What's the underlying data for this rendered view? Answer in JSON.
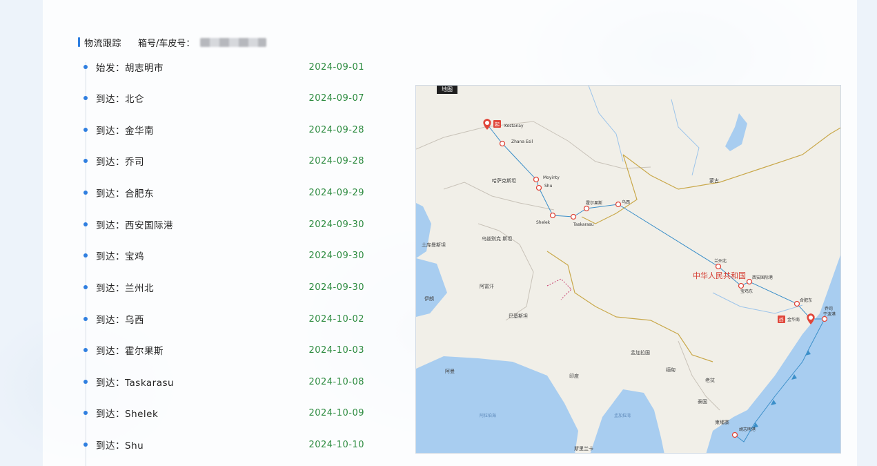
{
  "header": {
    "title": "物流跟踪",
    "box_label": "箱号/车皮号："
  },
  "timeline": [
    {
      "label": "始发：胡志明市",
      "date": "2024-09-01"
    },
    {
      "label": "到达：北仑",
      "date": "2024-09-07"
    },
    {
      "label": "到达：金华南",
      "date": "2024-09-28"
    },
    {
      "label": "到达：乔司",
      "date": "2024-09-28"
    },
    {
      "label": "到达：合肥东",
      "date": "2024-09-29"
    },
    {
      "label": "到达：西安国际港",
      "date": "2024-09-30"
    },
    {
      "label": "到达：宝鸡",
      "date": "2024-09-30"
    },
    {
      "label": "到达：兰州北",
      "date": "2024-09-30"
    },
    {
      "label": "到达：乌西",
      "date": "2024-10-02"
    },
    {
      "label": "到达：霍尔果斯",
      "date": "2024-10-03"
    },
    {
      "label": "到达：Taskarasu",
      "date": "2024-10-08"
    },
    {
      "label": "到达：Shelek",
      "date": "2024-10-09"
    },
    {
      "label": "到达：Shu",
      "date": "2024-10-10"
    }
  ],
  "map": {
    "badge": "地图",
    "country_labels": {
      "kazakhstan": "哈萨克斯坦",
      "mongolia": "蒙古",
      "uzbekistan": "乌兹别克\n斯坦",
      "turkmenistan": "土库曼斯坦",
      "afghanistan": "阿富汗",
      "iran": "伊朗",
      "pakistan": "巴基斯坦",
      "oman": "阿曼",
      "india": "印度",
      "bangladesh": "孟加拉国",
      "myanmar": "缅甸",
      "laos": "老挝",
      "thailand": "泰国",
      "cambodia": "柬埔寨",
      "srilanka": "斯里兰卡",
      "china": "中华人民共和国",
      "arabian_sea": "阿拉伯海",
      "bay_of_bengal": "孟加拉湾"
    },
    "station_labels": {
      "kostanay": "Kostanay",
      "zhana_esil": "Zhana Esil",
      "moyinty": "Moyinty",
      "shu": "Shu",
      "shelek": "Shelek",
      "taskarasu": "Taskarasu",
      "horgos": "霍尔果斯",
      "wuxi": "乌西",
      "lanzhou": "兰州北",
      "xian": "西安国际港",
      "baoji": "宝鸡东",
      "hefei": "合肥东",
      "qiaosi": "乔司",
      "ningbo": "宁波港",
      "jinhua": "金华南",
      "hcm": "胡志明港"
    },
    "origin_tag": "起",
    "dest_tag": "终",
    "route_color": "#3b8fc9",
    "marker_color": "#e0463a",
    "water_color": "#a8cdf0",
    "land_color": "#f1efe8",
    "china_label_color": "#d43a2f"
  }
}
